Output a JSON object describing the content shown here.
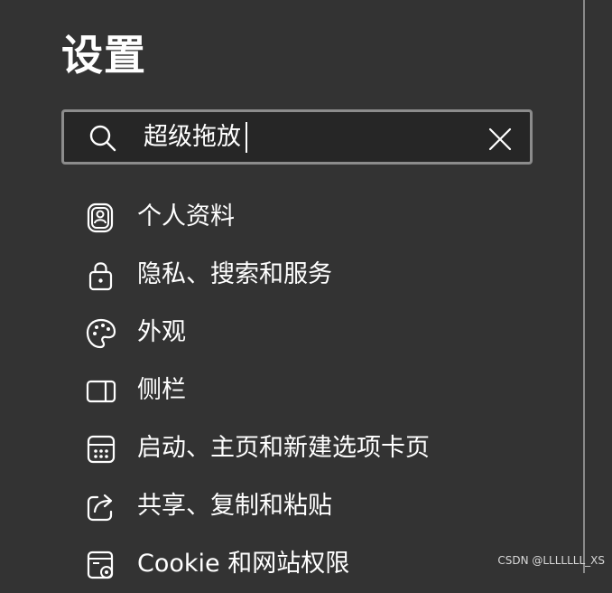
{
  "header": {
    "title": "设置"
  },
  "search": {
    "value": "超级拖放",
    "icon": "search-icon",
    "clear_icon": "close-icon"
  },
  "nav": {
    "items": [
      {
        "label": "个人资料",
        "icon": "profile-icon"
      },
      {
        "label": "隐私、搜索和服务",
        "icon": "lock-icon"
      },
      {
        "label": "外观",
        "icon": "palette-icon"
      },
      {
        "label": "侧栏",
        "icon": "sidebar-icon"
      },
      {
        "label": "启动、主页和新建选项卡页",
        "icon": "start-page-icon"
      },
      {
        "label": "共享、复制和粘贴",
        "icon": "share-icon"
      },
      {
        "label": "Cookie 和网站权限",
        "icon": "site-permissions-icon"
      }
    ]
  },
  "watermark": "CSDN @LLLLLLL_XS",
  "colors": {
    "background": "#333333",
    "search_background": "#262626",
    "search_border": "#8c8c8c",
    "text": "#ffffff"
  }
}
